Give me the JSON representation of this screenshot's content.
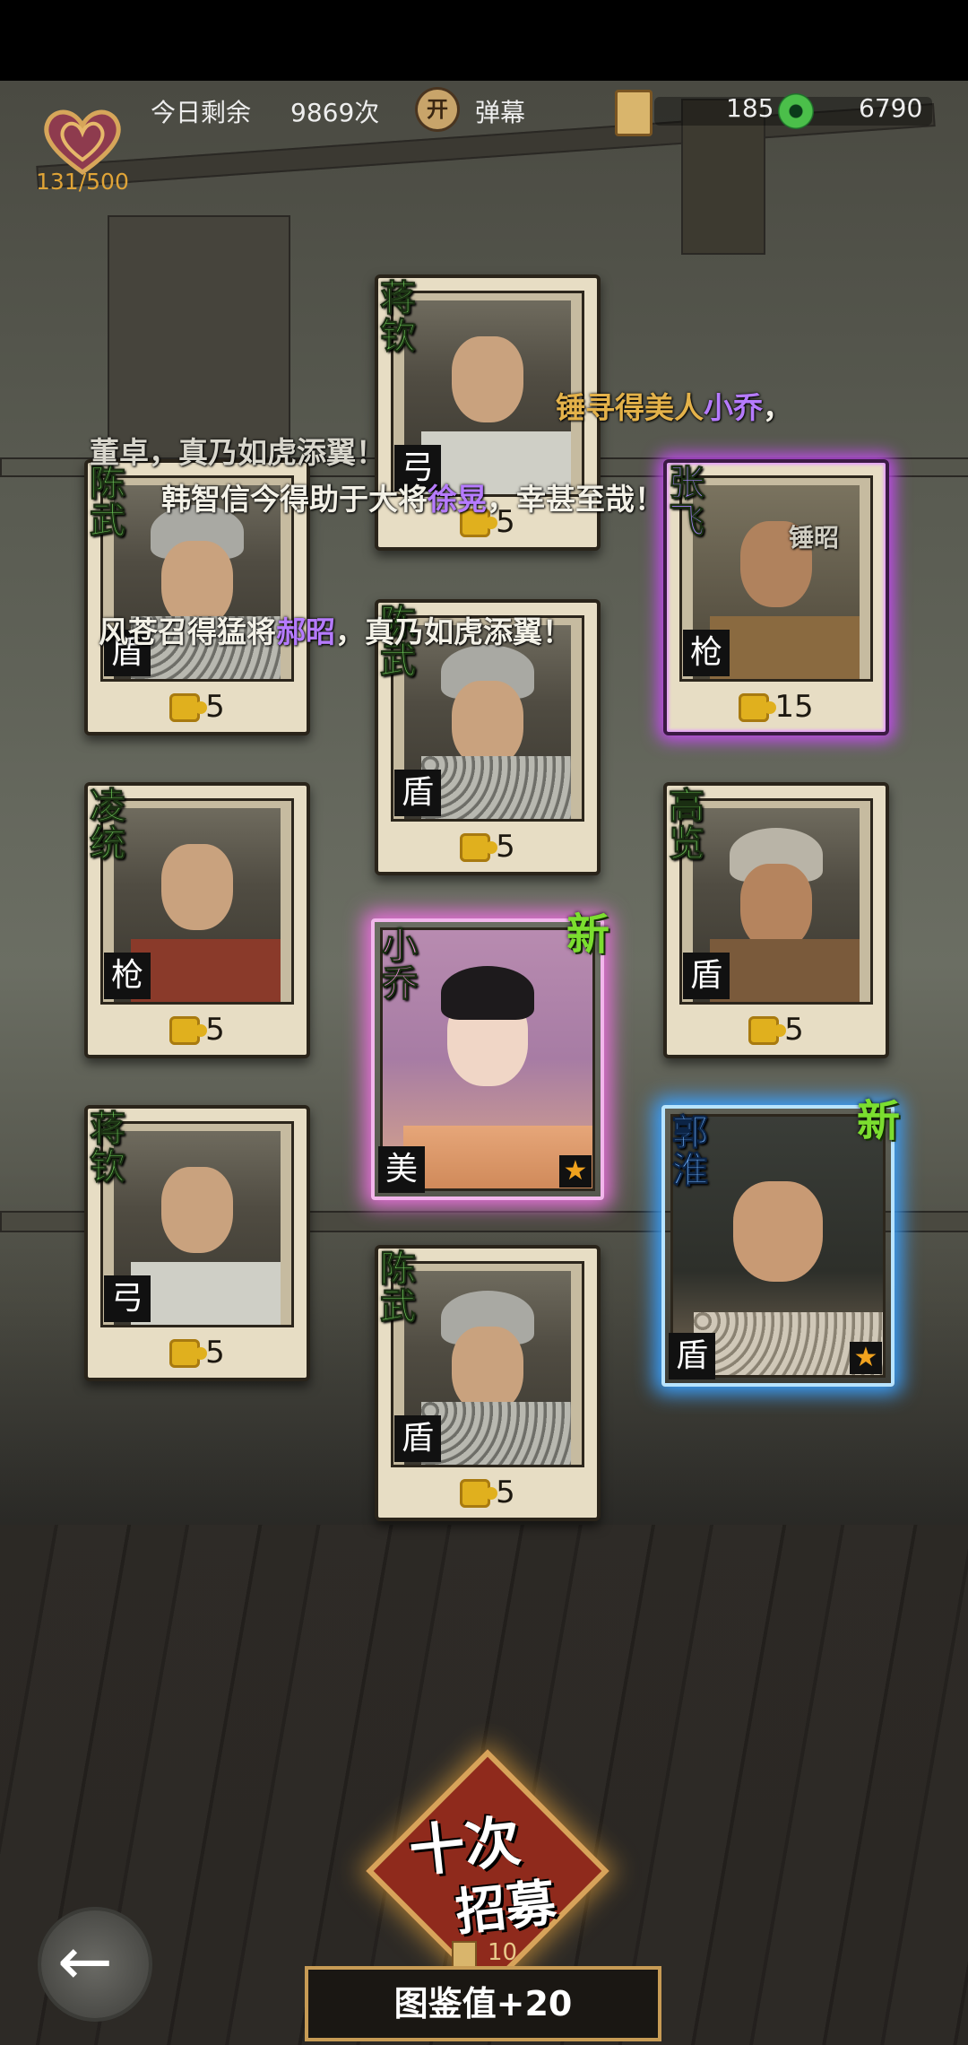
{
  "hud": {
    "hearts": "131/500",
    "remaining_label": "今日剩余",
    "remaining_count": "9869次",
    "barrage_toggle": "开",
    "barrage_label": "弹幕",
    "tickets": "185",
    "jade": "6790"
  },
  "cards": [
    {
      "name": "蒋钦",
      "type": "弓",
      "fragments": "5"
    },
    {
      "name": "陈武",
      "type": "盾",
      "fragments": "5"
    },
    {
      "name": "张飞",
      "type": "枪",
      "fragments": "15"
    },
    {
      "name": "陈武",
      "type": "盾",
      "fragments": "5"
    },
    {
      "name": "凌统",
      "type": "枪",
      "fragments": "5"
    },
    {
      "name": "高览",
      "type": "盾",
      "fragments": "5"
    },
    {
      "name": "小乔",
      "type": "美",
      "new": "新",
      "star": "★"
    },
    {
      "name": "蒋钦",
      "type": "弓",
      "fragments": "5"
    },
    {
      "name": "郭淮",
      "type": "盾",
      "new": "新",
      "star": "★"
    },
    {
      "name": "陈武",
      "type": "盾",
      "fragments": "5"
    }
  ],
  "danmaku": [
    {
      "a": "锤寻得美人",
      "b": "小乔",
      "c": "，"
    },
    {
      "a": "董卓，真乃如虎添翼！"
    },
    {
      "a": "韩智信今得助于大将",
      "b": "徐晃",
      "c": "，幸甚至哉！"
    },
    {
      "a": "锤昭"
    },
    {
      "a": "风苍召得猛将",
      "b": "郝昭",
      "c": "，真乃如虎添翼！"
    }
  ],
  "recruit": {
    "line1": "十次",
    "line2": "招募",
    "cost": "10"
  },
  "collection": "图鉴值+20",
  "colors": {
    "name_green": "#6fcb5a",
    "purple_glow": "#c34bf0",
    "pink_glow": "#e670d9",
    "blue_glow": "#3aa1ff",
    "new_green": "#7bde2f"
  }
}
